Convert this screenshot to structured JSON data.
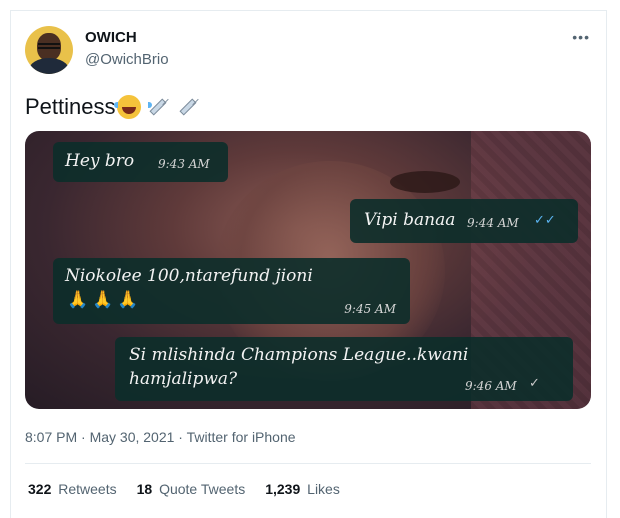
{
  "author": {
    "display_name": "OWICH",
    "handle": "@OwichBrio"
  },
  "menu_icon": "more-horizontal-icon",
  "tweet": {
    "text": "Pettiness",
    "emojis": [
      "face-with-tears-of-joy",
      "syringe",
      "syringe"
    ]
  },
  "media": {
    "chat": {
      "messages": [
        {
          "text": "Hey bro",
          "time": "9:43 AM",
          "direction": "incoming"
        },
        {
          "text": "Vipi banaa",
          "time": "9:44 AM",
          "direction": "outgoing",
          "ticks": "✓✓",
          "ticks_color": "#5ab3f0"
        },
        {
          "text": "Niokolee 100,ntarefund jioni",
          "extra": "🙏🙏🙏",
          "time": "9:45 AM",
          "direction": "incoming"
        },
        {
          "text": "Si mlishinda Champions League..kwani",
          "text2": "hamjalipwa?",
          "time": "9:46 AM",
          "direction": "outgoing",
          "ticks": "✓",
          "ticks_color": "#c8c8c8"
        }
      ]
    }
  },
  "meta": {
    "timestamp": "8:07 PM · May 30, 2021 · Twitter for iPhone"
  },
  "stats": {
    "retweets": {
      "count": "322",
      "label": "Retweets"
    },
    "quote_tweets": {
      "count": "18",
      "label": "Quote Tweets"
    },
    "likes": {
      "count": "1,239",
      "label": "Likes"
    }
  }
}
